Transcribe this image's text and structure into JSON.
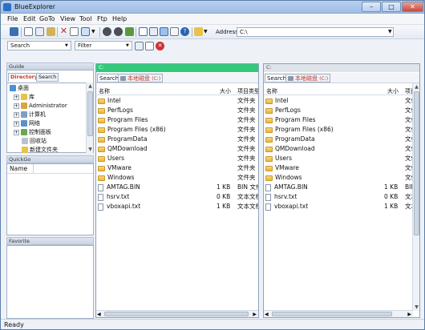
{
  "window": {
    "title": "BlueExplorer"
  },
  "menubar": {
    "items": [
      "File",
      "Edit",
      "GoTo",
      "View",
      "Tool",
      "Ftp",
      "Help"
    ]
  },
  "toolbar": {
    "address_label": "Address",
    "address_value": "C:\\"
  },
  "search": {
    "search_label": "Search",
    "filter_label": "Filter"
  },
  "guide": {
    "title": "Guide",
    "tabs": [
      "Directory",
      "Search"
    ],
    "tree": [
      {
        "label": "桌面",
        "expander": ""
      },
      {
        "label": "库",
        "expander": "+"
      },
      {
        "label": "Administrator",
        "expander": "+"
      },
      {
        "label": "计算机",
        "expander": "+"
      },
      {
        "label": "网络",
        "expander": "+"
      },
      {
        "label": "控制面板",
        "expander": "+"
      },
      {
        "label": "回收站",
        "expander": ""
      },
      {
        "label": "新建文件夹",
        "expander": ""
      }
    ]
  },
  "quickgo": {
    "title": "QuickGo",
    "column": "Name"
  },
  "favorite": {
    "title": "Favorite"
  },
  "left_pane": {
    "path": "C:",
    "tab_search": "Search",
    "tab_drive": "本地磁盘",
    "tab_drive_suffix": "(C:)",
    "col_name": "名称",
    "col_size": "大小",
    "col_type": "项目类型"
  },
  "right_pane": {
    "path": "C:",
    "tab_search": "Search",
    "tab_drive": "本地磁盘",
    "tab_drive_suffix": "(C:)",
    "col_name": "名称",
    "col_size": "大小",
    "col_type": "项目类型"
  },
  "left_files": [
    {
      "name": "Intel",
      "size": "",
      "type": "文件夹",
      "kind": "folder"
    },
    {
      "name": "PerfLogs",
      "size": "",
      "type": "文件夹",
      "kind": "folder"
    },
    {
      "name": "Program Files",
      "size": "",
      "type": "文件夹",
      "kind": "folder"
    },
    {
      "name": "Program Files (x86)",
      "size": "",
      "type": "文件夹",
      "kind": "folder"
    },
    {
      "name": "ProgramData",
      "size": "",
      "type": "文件夹",
      "kind": "folder"
    },
    {
      "name": "QMDownload",
      "size": "",
      "type": "文件夹",
      "kind": "folder"
    },
    {
      "name": "Users",
      "size": "",
      "type": "文件夹",
      "kind": "folder"
    },
    {
      "name": "VMware",
      "size": "",
      "type": "文件夹",
      "kind": "folder"
    },
    {
      "name": "Windows",
      "size": "",
      "type": "文件夹",
      "kind": "folder"
    },
    {
      "name": "AMTAG.BIN",
      "size": "1 KB",
      "type": "BIN 文件",
      "kind": "file"
    },
    {
      "name": "hsrv.txt",
      "size": "0 KB",
      "type": "文本文档",
      "kind": "file"
    },
    {
      "name": "vboxapi.txt",
      "size": "1 KB",
      "type": "文本文档",
      "kind": "file"
    }
  ],
  "right_files": [
    {
      "name": "Intel",
      "size": "",
      "type": "文件夹",
      "kind": "folder"
    },
    {
      "name": "PerfLogs",
      "size": "",
      "type": "文件夹",
      "kind": "folder"
    },
    {
      "name": "Program Files",
      "size": "",
      "type": "文件夹",
      "kind": "folder"
    },
    {
      "name": "Program Files (x86)",
      "size": "",
      "type": "文件夹",
      "kind": "folder"
    },
    {
      "name": "ProgramData",
      "size": "",
      "type": "文件夹",
      "kind": "folder"
    },
    {
      "name": "QMDownload",
      "size": "",
      "type": "文件夹",
      "kind": "folder"
    },
    {
      "name": "Users",
      "size": "",
      "type": "文件夹",
      "kind": "folder"
    },
    {
      "name": "VMware",
      "size": "",
      "type": "文件夹",
      "kind": "folder"
    },
    {
      "name": "Windows",
      "size": "",
      "type": "文件夹",
      "kind": "folder"
    },
    {
      "name": "AMTAG.BIN",
      "size": "1 KB",
      "type": "BIN 文件",
      "kind": "file"
    },
    {
      "name": "hsrv.txt",
      "size": "0 KB",
      "type": "文本文档",
      "kind": "file"
    },
    {
      "name": "vboxapi.txt",
      "size": "1 KB",
      "type": "文本文档",
      "kind": "file"
    }
  ],
  "status": {
    "text": "Ready"
  },
  "colors": {
    "active_pane_header": "#33c97a",
    "inactive_pane_header": "#dfe3ea",
    "drive_tab_text": "#c0392b"
  }
}
